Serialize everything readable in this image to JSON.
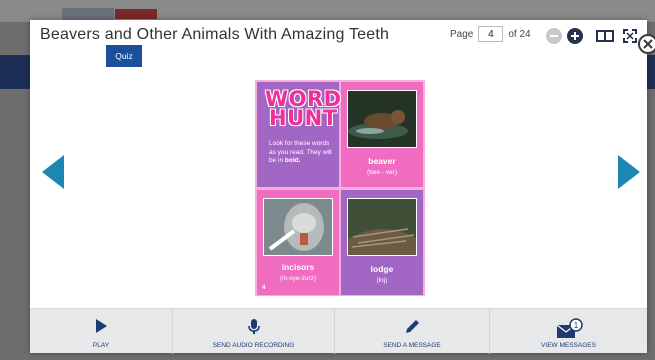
{
  "header": {
    "title": "Beavers and Other Animals With Amazing Teeth",
    "quiz_label": "Quiz",
    "page_prefix": "Page",
    "page_current": "4",
    "page_total_text": "of 24"
  },
  "icons": {
    "zoom_out": "minus-circle",
    "zoom_in": "plus-circle",
    "single_page": "book-view",
    "fullscreen": "expand",
    "close": "close-x"
  },
  "book": {
    "word_hunt_line1": "WORD",
    "word_hunt_line2": "HUNT",
    "instructions_pre": "Look for these words as you read. They will be in ",
    "instructions_bold": "bold.",
    "page_number": "4",
    "words": [
      {
        "word": "beaver",
        "pronunciation": "(bee - ver)"
      },
      {
        "word": "incisors",
        "pronunciation": "(in-sye-zurz)"
      },
      {
        "word": "lodge",
        "pronunciation": "(loj)"
      }
    ]
  },
  "footer": {
    "items": [
      {
        "label": "PLAY"
      },
      {
        "label": "SEND AUDIO RECORDING"
      },
      {
        "label": "SEND A MESSAGE"
      },
      {
        "label": "VIEW MESSAGES",
        "badge": "1"
      }
    ]
  },
  "colors": {
    "accent_blue": "#1b4f9c",
    "arrow_teal": "#1c87b3",
    "panel_purple": "#a266c4",
    "panel_pink": "#f06cc1",
    "navy": "#1e2f55"
  }
}
